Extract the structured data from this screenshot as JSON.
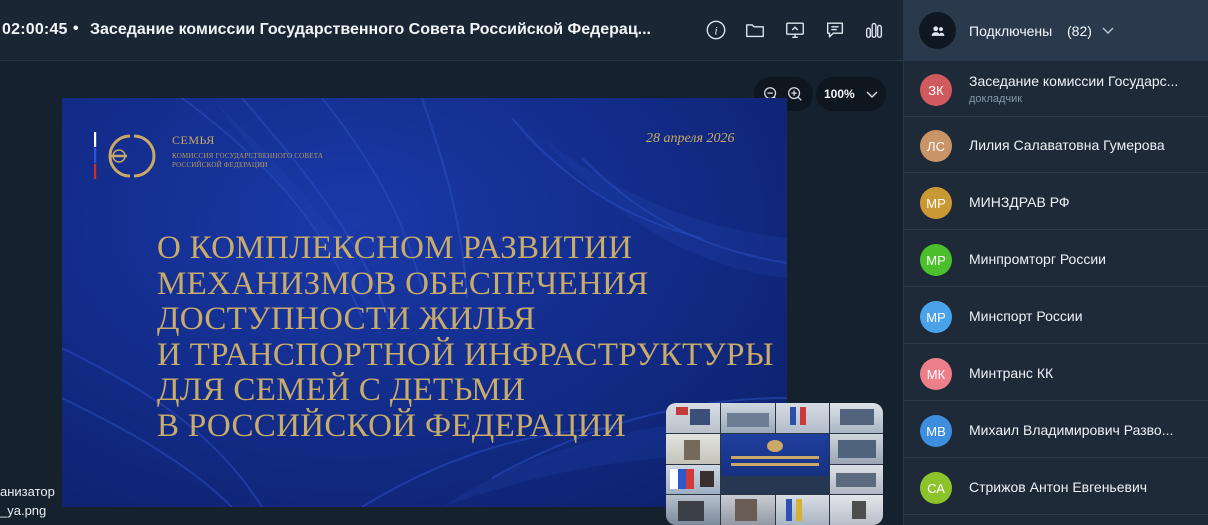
{
  "header": {
    "timer": "02:00:45",
    "separator": "•",
    "title": "Заседание комиссии Государственного Совета Российской Федерац...",
    "icons": [
      "info-icon",
      "folder-icon",
      "screen-share-icon",
      "chat-icon",
      "stats-icon"
    ]
  },
  "zoom": {
    "level": "100%",
    "zoom_out_icon": "zoom-out-icon",
    "zoom_in_icon": "zoom-in-icon"
  },
  "slide": {
    "logo_title": "СЕМЬЯ",
    "logo_sub1": "КОМИССИЯ ГОСУДАРСТВЕННОГО СОВЕТА",
    "logo_sub2": "РОССИЙСКОЙ ФЕДЕРАЦИИ",
    "date": "28 апреля 2026",
    "headline": [
      "О комплексном развитии",
      "механизмов обеспечения",
      "доступности жилья",
      "и транспортной инфраструктуры",
      "для семей с детьми",
      "в Российской Федерации"
    ]
  },
  "edge_labels": {
    "line1": "анизатор",
    "line2": "_ya.png"
  },
  "sidebar": {
    "header_label": "Подключены",
    "header_count": "(82)",
    "participants": [
      {
        "initials": "ЗК",
        "name": "Заседание комиссии Государс...",
        "role": "докладчик",
        "color": "#d05a5e"
      },
      {
        "initials": "ЛС",
        "name": "Лилия Салаватовна Гумерова",
        "role": "",
        "color": "#c99566"
      },
      {
        "initials": "МР",
        "name": "МИНЗДРАВ РФ",
        "role": "",
        "color": "#c99833"
      },
      {
        "initials": "МР",
        "name": "Минпромторг России",
        "role": "",
        "color": "#4dbf2c"
      },
      {
        "initials": "МР",
        "name": "Минспорт России",
        "role": "",
        "color": "#4aa3ea"
      },
      {
        "initials": "МК",
        "name": "Минтранс КК",
        "role": "",
        "color": "#ec7f8a"
      },
      {
        "initials": "МВ",
        "name": "Михаил Владимирович Разво...",
        "role": "",
        "color": "#3e8ee0"
      },
      {
        "initials": "СА",
        "name": "Стрижов Антон Евгеньевич",
        "role": "",
        "color": "#8dc22b"
      }
    ]
  }
}
